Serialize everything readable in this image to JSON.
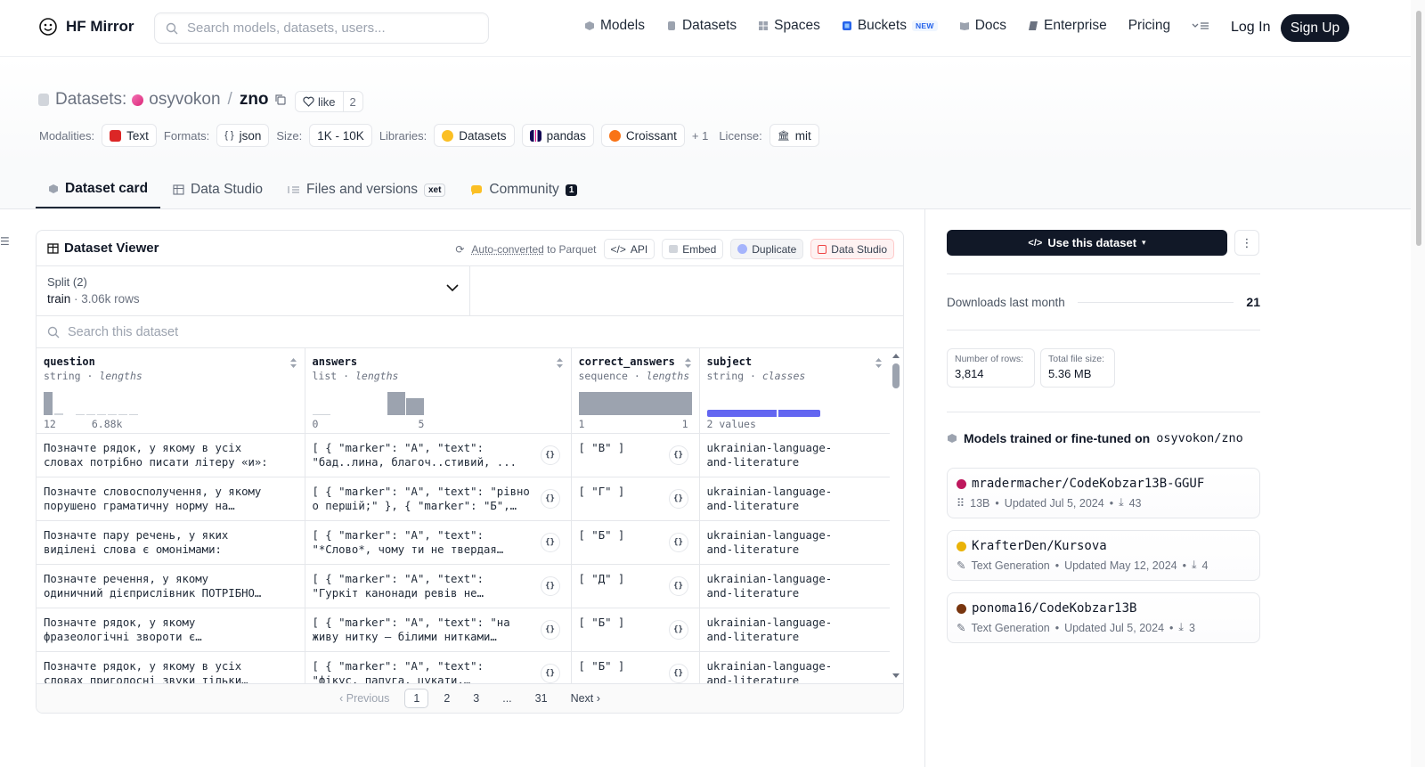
{
  "nav": {
    "brand": "HF Mirror",
    "search_placeholder": "Search models, datasets, users...",
    "links": [
      {
        "label": "Models",
        "icon": "cube-icon"
      },
      {
        "label": "Datasets",
        "icon": "database-icon"
      },
      {
        "label": "Spaces",
        "icon": "grid-icon"
      },
      {
        "label": "Buckets",
        "icon": "bucket-icon",
        "badge": "NEW"
      },
      {
        "label": "Docs",
        "icon": "book-icon"
      },
      {
        "label": "Enterprise",
        "icon": "enterprise-icon"
      },
      {
        "label": "Pricing"
      }
    ],
    "login": "Log In",
    "signup": "Sign Up"
  },
  "dataset": {
    "section_label": "Datasets:",
    "owner": "osyvokon",
    "name": "zno",
    "like_label": "like",
    "like_count": "2",
    "meta": {
      "modalities_label": "Modalities:",
      "modality": "Text",
      "formats_label": "Formats:",
      "format": "json",
      "size_label": "Size:",
      "size": "1K - 10K",
      "libraries_label": "Libraries:",
      "libraries": [
        "Datasets",
        "pandas",
        "Croissant"
      ],
      "libraries_more": "+ 1",
      "license_label": "License:",
      "license": "mit"
    }
  },
  "tabs": {
    "card": "Dataset card",
    "studio": "Data Studio",
    "files": "Files and versions",
    "xet": "xet",
    "community": "Community",
    "community_count": "1"
  },
  "viewer": {
    "title": "Dataset Viewer",
    "autoconv": "Auto-converted",
    "autoconv_suffix": "to Parquet",
    "api": "API",
    "embed": "Embed",
    "duplicate": "Duplicate",
    "data_studio": "Data Studio",
    "split_label": "Split (2)",
    "split_name": "train",
    "split_rows": "3.06k rows",
    "search_placeholder": "Search this dataset",
    "columns": [
      {
        "name": "question",
        "type": "string",
        "stat": "lengths",
        "min": "12",
        "max": "6.88k"
      },
      {
        "name": "answers",
        "type": "list",
        "stat": "lengths",
        "min": "0",
        "max": "5"
      },
      {
        "name": "correct_answers",
        "type": "sequence",
        "stat": "lengths",
        "min": "1",
        "max": "1"
      },
      {
        "name": "subject",
        "type": "string",
        "stat": "classes",
        "values": "2 values"
      }
    ],
    "rows": [
      {
        "q": "Позначте рядок, у якому в усіх словах потрібно писати літеру «и»:",
        "a": "[ { \"marker\": \"А\", \"text\": \"бад..лина, благоч..стивий, ...",
        "c": "[ \"В\" ]",
        "s": "ukrainian-language-and-literature"
      },
      {
        "q": "Позначте словосполучення, у якому порушено граматичну норму на позначення...",
        "a": "[ { \"marker\": \"А\", \"text\": \"рівно о першій;\" }, { \"marker\": \"Б\", ...",
        "c": "[ \"Г\" ]",
        "s": "ukrainian-language-and-literature"
      },
      {
        "q": "Позначте пару речень, у яких виділені слова є омонімами:",
        "a": "[ { \"marker\": \"А\", \"text\": \"*Слово*, чому ти не твердая криця...",
        "c": "[ \"Б\" ]",
        "s": "ukrainian-language-and-literature"
      },
      {
        "q": "Позначте речення, у якому одиничний дієприслівник ПОТРІБНО відокремити комо...",
        "a": "[ { \"marker\": \"А\", \"text\": \"Гуркіт канонади ревів не перестаючи.\" }, ...",
        "c": "[ \"Д\" ]",
        "s": "ukrainian-language-and-literature"
      },
      {
        "q": "Позначте рядок, у якому фразеологічні звороти є синонімічними:",
        "a": "[ { \"marker\": \"А\", \"text\": \"на живу нитку – білими нитками шитий;\" }, ...",
        "c": "[ \"Б\" ]",
        "s": "ukrainian-language-and-literature"
      },
      {
        "q": "Позначте рядок, у якому в усіх словах приголосні звуки тільки глухі:",
        "a": "[ { \"marker\": \"А\", \"text\": \"фікус, папуга, цукати, тьохкати;\" }, {...",
        "c": "[ \"Б\" ]",
        "s": "ukrainian-language-and-literature"
      }
    ],
    "json_btn": "{}",
    "pager": {
      "prev": "Previous",
      "pages": [
        "1",
        "2",
        "3",
        "...",
        "31"
      ],
      "next": "Next"
    }
  },
  "sidebar": {
    "use_button": "Use this dataset",
    "downloads_label": "Downloads last month",
    "downloads_value": "21",
    "rows_label": "Number of rows:",
    "rows_value": "3,814",
    "filesize_label": "Total file size:",
    "filesize_value": "5.36 MB",
    "models_title": "Models trained or fine-tuned on",
    "models_title_ref": "osyvokon/zno",
    "models": [
      {
        "name": "mradermacher/CodeKobzar13B-GGUF",
        "kind": "13B",
        "updated": "Updated Jul 5, 2024",
        "downloads": "43",
        "dot": "#be185d"
      },
      {
        "name": "KrafterDen/Kursova",
        "kind": "Text Generation",
        "updated": "Updated May 12, 2024",
        "downloads": "4",
        "dot": "#eab308"
      },
      {
        "name": "ponoma16/CodeKobzar13B",
        "kind": "Text Generation",
        "updated": "Updated Jul 5, 2024",
        "downloads": "3",
        "dot": "#78350f"
      }
    ]
  }
}
